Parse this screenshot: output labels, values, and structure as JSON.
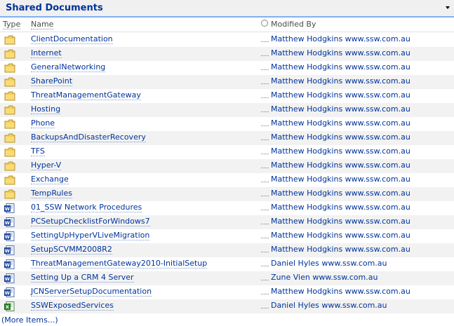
{
  "webpart": {
    "title": "Shared Documents"
  },
  "columns": {
    "type": "Type",
    "name": "Name",
    "modified_by": "Modified By"
  },
  "rows": [
    {
      "icon": "folder-icon",
      "name": "ClientDocumentation",
      "modified_by": "Matthew Hodgkins www.ssw.com.au"
    },
    {
      "icon": "folder-icon",
      "name": "Internet",
      "modified_by": "Matthew Hodgkins www.ssw.com.au"
    },
    {
      "icon": "folder-icon",
      "name": "GeneralNetworking",
      "modified_by": "Matthew Hodgkins www.ssw.com.au"
    },
    {
      "icon": "folder-icon",
      "name": "SharePoint",
      "modified_by": "Matthew Hodgkins www.ssw.com.au"
    },
    {
      "icon": "folder-icon",
      "name": "ThreatManagementGateway",
      "modified_by": "Matthew Hodgkins www.ssw.com.au"
    },
    {
      "icon": "folder-icon",
      "name": "Hosting",
      "modified_by": "Matthew Hodgkins www.ssw.com.au"
    },
    {
      "icon": "folder-icon",
      "name": "Phone",
      "modified_by": "Matthew Hodgkins www.ssw.com.au"
    },
    {
      "icon": "folder-icon",
      "name": "BackupsAndDisasterRecovery",
      "modified_by": "Matthew Hodgkins www.ssw.com.au"
    },
    {
      "icon": "folder-icon",
      "name": "TFS",
      "modified_by": "Matthew Hodgkins www.ssw.com.au"
    },
    {
      "icon": "folder-icon",
      "name": "Hyper-V",
      "modified_by": "Matthew Hodgkins www.ssw.com.au"
    },
    {
      "icon": "folder-icon",
      "name": "Exchange",
      "modified_by": "Matthew Hodgkins www.ssw.com.au"
    },
    {
      "icon": "folder-icon",
      "name": "TempRules",
      "modified_by": "Matthew Hodgkins www.ssw.com.au"
    },
    {
      "icon": "word-doc-icon",
      "name": "01_SSW Network Procedures",
      "modified_by": "Matthew Hodgkins www.ssw.com.au"
    },
    {
      "icon": "word-doc-icon",
      "name": "PCSetupChecklistForWindows7",
      "modified_by": "Matthew Hodgkins www.ssw.com.au"
    },
    {
      "icon": "word-doc-icon",
      "name": "SettingUpHyperVLiveMigration",
      "modified_by": "Matthew Hodgkins www.ssw.com.au"
    },
    {
      "icon": "word-doc-icon",
      "name": "SetupSCVMM2008R2",
      "modified_by": "Matthew Hodgkins www.ssw.com.au"
    },
    {
      "icon": "word-doc-icon",
      "name": "ThreatManagementGateway2010-InitialSetup",
      "modified_by": "Daniel Hyles www.ssw.com.au"
    },
    {
      "icon": "word-doc-icon",
      "name": "Setting Up a CRM 4 Server",
      "modified_by": "Zune Vien www.ssw.com.au"
    },
    {
      "icon": "word-doc-icon",
      "name": "JCNServerSetupDocumentation",
      "modified_by": "Matthew Hodgkins www.ssw.com.au"
    },
    {
      "icon": "excel-doc-icon",
      "name": "SSWExposedServices",
      "modified_by": "Daniel Hyles www.ssw.com.au"
    }
  ],
  "footer": {
    "more_items": "(More Items...)"
  },
  "colors": {
    "link": "#003399",
    "header_border": "#83b0ec",
    "alt_row": "#f2f2f2"
  }
}
